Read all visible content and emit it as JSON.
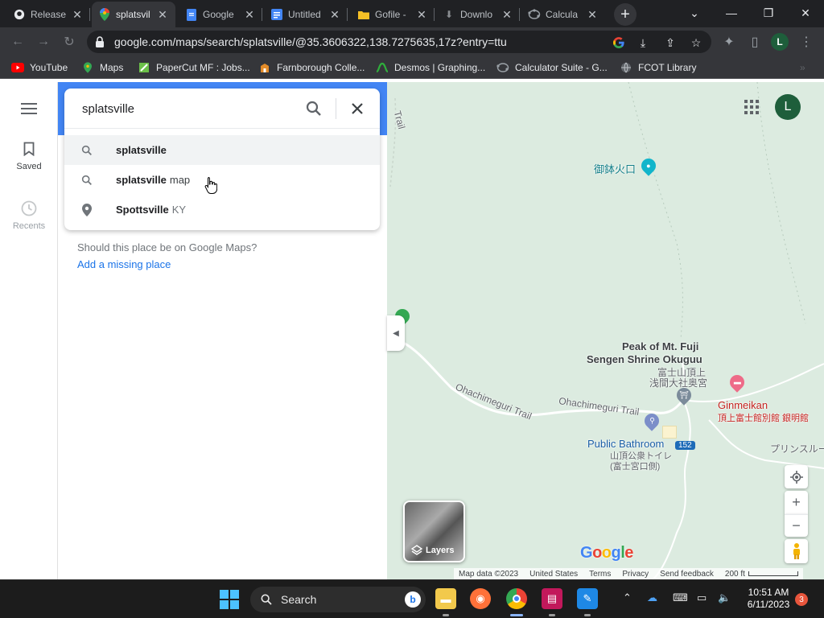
{
  "browser": {
    "tabs": [
      {
        "title": "Release",
        "icon": "github-icon"
      },
      {
        "title": "splatsvil",
        "icon": "google-maps-icon",
        "active": true
      },
      {
        "title": "Google",
        "icon": "google-docs-icon"
      },
      {
        "title": "Untitled",
        "icon": "google-docs-icon"
      },
      {
        "title": "Gofile -",
        "icon": "gofile-icon"
      },
      {
        "title": "Downlo",
        "icon": "download-icon"
      },
      {
        "title": "Calcula",
        "icon": "geogebra-icon"
      }
    ],
    "url": "google.com/maps/search/splatsville/@35.3606322,138.7275635,17z?entry=ttu",
    "profile_initial": "L",
    "bookmarks": [
      {
        "label": "YouTube",
        "icon": "youtube-icon"
      },
      {
        "label": "Maps",
        "icon": "google-maps-icon"
      },
      {
        "label": "PaperCut MF : Jobs...",
        "icon": "papercut-icon"
      },
      {
        "label": "Farnborough Colle...",
        "icon": "college-icon"
      },
      {
        "label": "Desmos | Graphing...",
        "icon": "desmos-icon"
      },
      {
        "label": "Calculator Suite - G...",
        "icon": "geogebra-icon"
      },
      {
        "label": "FCOT Library",
        "icon": "globe-icon"
      }
    ]
  },
  "rail": {
    "saved_label": "Saved",
    "recents_label": "Recents"
  },
  "search": {
    "query": "splatsville",
    "suggestions": [
      {
        "bold": "splatsville",
        "rest": "",
        "icon": "search-icon"
      },
      {
        "bold": "splatsville",
        "rest": "map",
        "icon": "search-icon"
      },
      {
        "bold": "Spottsville",
        "rest": "KY",
        "icon": "place-pin-icon"
      }
    ]
  },
  "missing_place": {
    "question": "Should this place be on Google Maps?",
    "link": "Add a missing place"
  },
  "map": {
    "labels": {
      "trail_top": "Trail",
      "crater": "御鉢火口",
      "peak_line1": "Peak of Mt. Fuji",
      "peak_line2": "Sengen Shrine Okuguu",
      "peak_jp1": "富士山頂上",
      "peak_jp2": "浅間大社奥宮",
      "ohachimeguri_1": "Ohachimeguri Trail",
      "ohachimeguri_2": "Ohachimeguri Trail",
      "ginmeikan": "Ginmeikan",
      "ginmeikan_jp": "頂上富士館別館 銀明館",
      "princeroute": "プリンスルー",
      "bathroom": "Public Bathroom",
      "bathroom_jp1": "山頂公衆トイレ",
      "bathroom_jp2": "(富士宮口側)",
      "route_number": "152"
    },
    "account_initial": "L",
    "layers_label": "Layers",
    "logo": "Google",
    "attribution": [
      "Map data ©2023",
      "United States",
      "Terms",
      "Privacy",
      "Send feedback",
      "200 ft"
    ],
    "colors": {
      "map_bg": "#dcebe0",
      "accent": "#4285f4"
    }
  },
  "taskbar": {
    "search_label": "Search",
    "time": "10:51 AM",
    "date": "6/11/2023",
    "notification_count": "3"
  }
}
